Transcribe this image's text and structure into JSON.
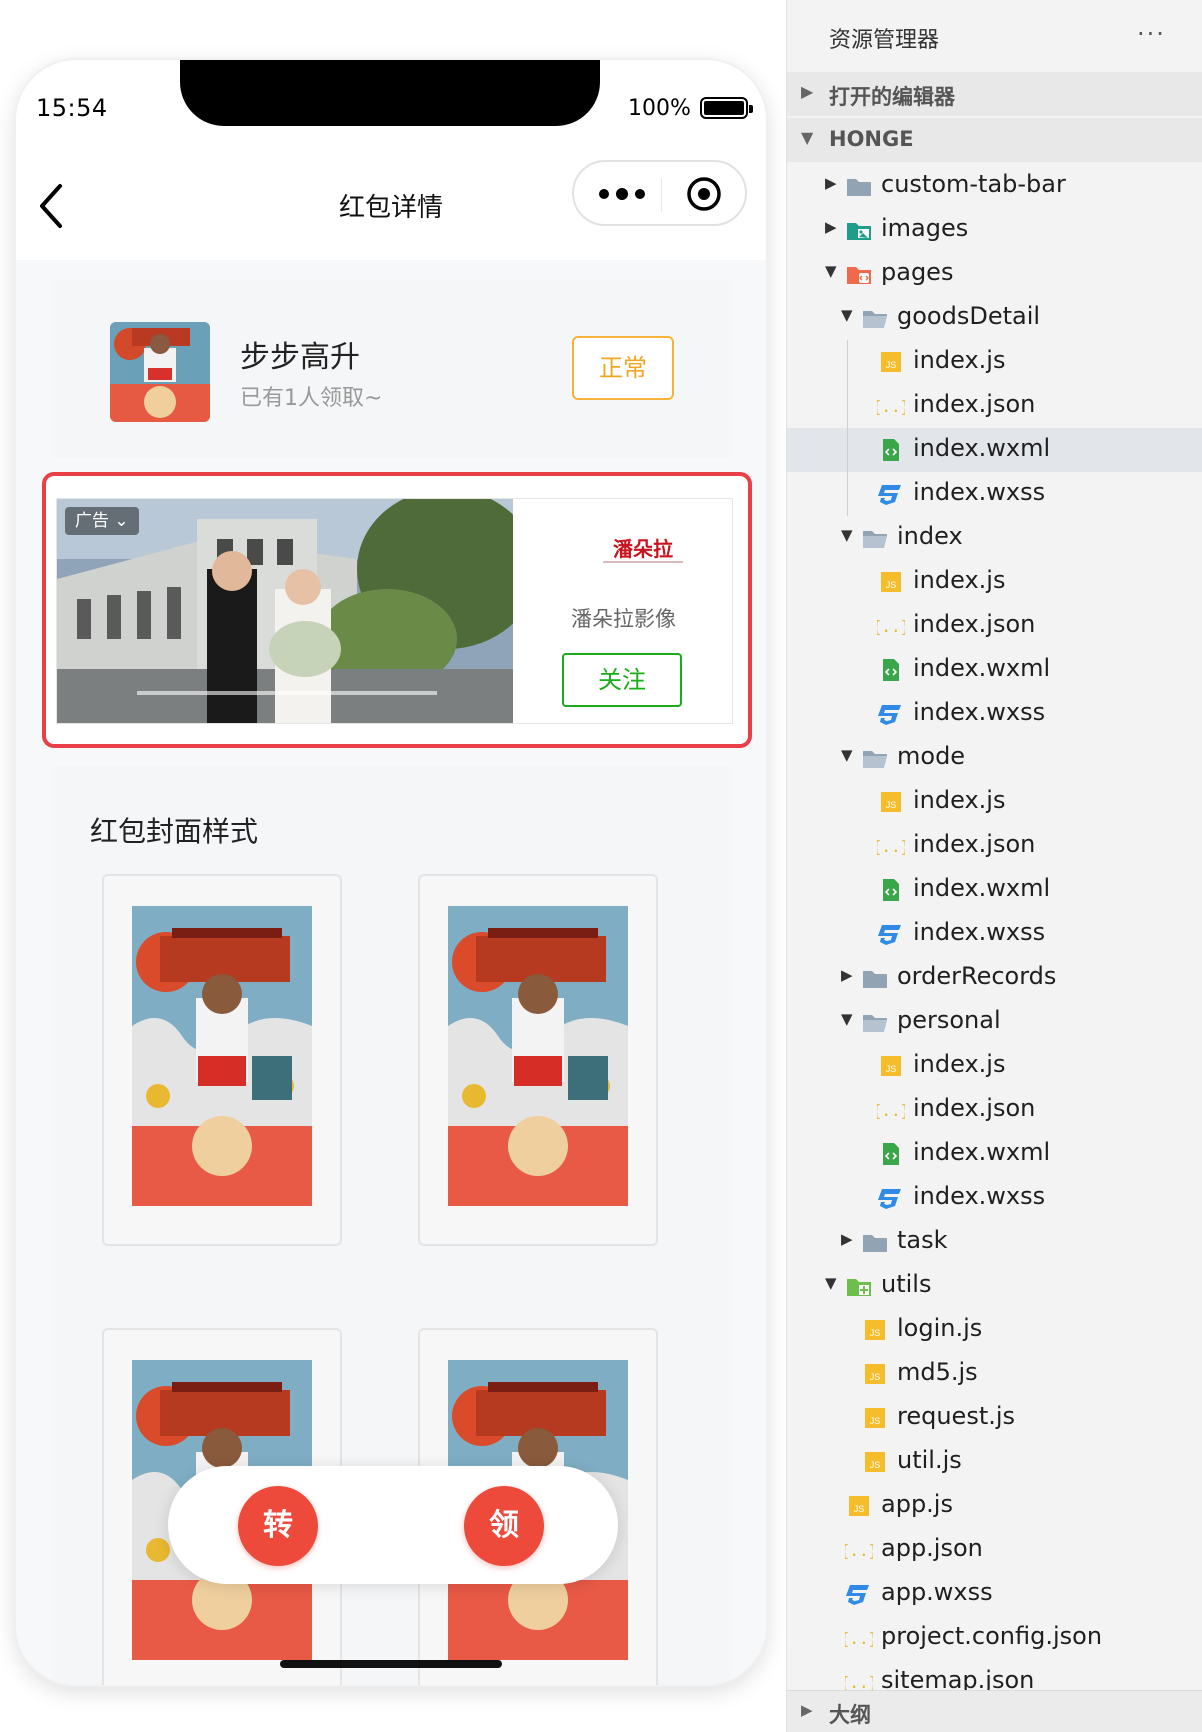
{
  "phone": {
    "status": {
      "time": "15:54",
      "battery": "100%"
    },
    "nav": {
      "title": "红包详情"
    },
    "packet": {
      "title": "步步高升",
      "subtitle": "已有1人领取~",
      "status_label": "正常"
    },
    "ad": {
      "tag": "广告",
      "tag_caret": "⌄",
      "brand_logo": "潘朵拉",
      "brand_name": "潘朵拉影像",
      "follow_label": "关注"
    },
    "cover_section": {
      "title": "红包封面样式"
    },
    "actions": {
      "transfer_label": "转",
      "receive_label": "领"
    },
    "colors": {
      "accent_red": "#ED4A3C",
      "status_orange": "#F4A623",
      "follow_green": "#1AAD19",
      "ad_border": "#E94048"
    }
  },
  "explorer": {
    "title": "资源管理器",
    "menu": "···",
    "open_editors": "打开的编辑器",
    "project": "HONGE",
    "outline": "大纲",
    "tree": [
      {
        "name": "custom-tab-bar",
        "type": "folder",
        "icon": "folder-icon",
        "depth": 0,
        "state": "collapsed"
      },
      {
        "name": "images",
        "type": "folder",
        "icon": "images-folder-icon",
        "depth": 0,
        "state": "collapsed"
      },
      {
        "name": "pages",
        "type": "folder",
        "icon": "pages-folder-icon",
        "depth": 0,
        "state": "expanded"
      },
      {
        "name": "goodsDetail",
        "type": "folder",
        "icon": "folder-open-icon",
        "depth": 1,
        "state": "expanded"
      },
      {
        "name": "index.js",
        "type": "js",
        "icon": "js-file-icon",
        "depth": 2
      },
      {
        "name": "index.json",
        "type": "json",
        "icon": "json-file-icon",
        "depth": 2
      },
      {
        "name": "index.wxml",
        "type": "wxml",
        "icon": "wxml-file-icon",
        "depth": 2,
        "selected": true
      },
      {
        "name": "index.wxss",
        "type": "wxss",
        "icon": "wxss-file-icon",
        "depth": 2
      },
      {
        "name": "index",
        "type": "folder",
        "icon": "folder-open-icon",
        "depth": 1,
        "state": "expanded"
      },
      {
        "name": "index.js",
        "type": "js",
        "icon": "js-file-icon",
        "depth": 2
      },
      {
        "name": "index.json",
        "type": "json",
        "icon": "json-file-icon",
        "depth": 2
      },
      {
        "name": "index.wxml",
        "type": "wxml",
        "icon": "wxml-file-icon",
        "depth": 2
      },
      {
        "name": "index.wxss",
        "type": "wxss",
        "icon": "wxss-file-icon",
        "depth": 2
      },
      {
        "name": "mode",
        "type": "folder",
        "icon": "folder-open-icon",
        "depth": 1,
        "state": "expanded"
      },
      {
        "name": "index.js",
        "type": "js",
        "icon": "js-file-icon",
        "depth": 2
      },
      {
        "name": "index.json",
        "type": "json",
        "icon": "json-file-icon",
        "depth": 2
      },
      {
        "name": "index.wxml",
        "type": "wxml",
        "icon": "wxml-file-icon",
        "depth": 2
      },
      {
        "name": "index.wxss",
        "type": "wxss",
        "icon": "wxss-file-icon",
        "depth": 2
      },
      {
        "name": "orderRecords",
        "type": "folder",
        "icon": "folder-icon",
        "depth": 1,
        "state": "collapsed"
      },
      {
        "name": "personal",
        "type": "folder",
        "icon": "folder-open-icon",
        "depth": 1,
        "state": "expanded"
      },
      {
        "name": "index.js",
        "type": "js",
        "icon": "js-file-icon",
        "depth": 2
      },
      {
        "name": "index.json",
        "type": "json",
        "icon": "json-file-icon",
        "depth": 2
      },
      {
        "name": "index.wxml",
        "type": "wxml",
        "icon": "wxml-file-icon",
        "depth": 2
      },
      {
        "name": "index.wxss",
        "type": "wxss",
        "icon": "wxss-file-icon",
        "depth": 2
      },
      {
        "name": "task",
        "type": "folder",
        "icon": "folder-icon",
        "depth": 1,
        "state": "collapsed"
      },
      {
        "name": "utils",
        "type": "folder",
        "icon": "utils-folder-icon",
        "depth": 0,
        "state": "expanded"
      },
      {
        "name": "login.js",
        "type": "js",
        "icon": "js-file-icon",
        "depth": 1
      },
      {
        "name": "md5.js",
        "type": "js",
        "icon": "js-file-icon",
        "depth": 1
      },
      {
        "name": "request.js",
        "type": "js",
        "icon": "js-file-icon",
        "depth": 1
      },
      {
        "name": "util.js",
        "type": "js",
        "icon": "js-file-icon",
        "depth": 1
      },
      {
        "name": "app.js",
        "type": "js",
        "icon": "js-file-icon",
        "depth": 0
      },
      {
        "name": "app.json",
        "type": "json",
        "icon": "json-file-icon",
        "depth": 0
      },
      {
        "name": "app.wxss",
        "type": "wxss",
        "icon": "wxss-file-icon",
        "depth": 0
      },
      {
        "name": "project.config.json",
        "type": "json",
        "icon": "json-file-icon",
        "depth": 0
      },
      {
        "name": "sitemap.json",
        "type": "json",
        "icon": "json-file-icon",
        "depth": 0
      }
    ]
  }
}
